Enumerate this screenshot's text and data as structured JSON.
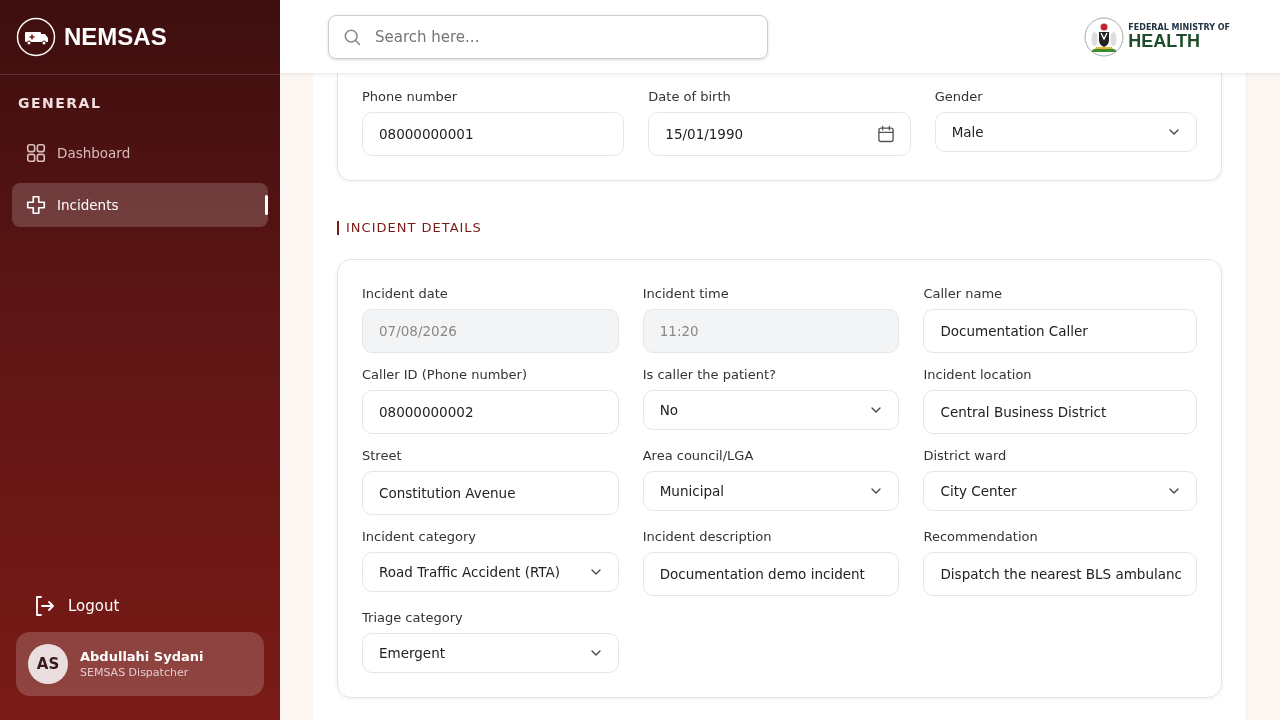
{
  "sidebar": {
    "brand": "NEMSAS",
    "section": "GENERAL",
    "items": [
      {
        "label": "Dashboard",
        "kind": "grid",
        "selected": false
      },
      {
        "label": "Incidents",
        "kind": "cross",
        "selected": true
      }
    ],
    "logout": "Logout",
    "user": {
      "initials": "AS",
      "name": "Abdullahi Sydani",
      "role": "SEMSAS Dispatcher"
    }
  },
  "header": {
    "search": {
      "placeholder": "Search here..."
    },
    "ministry": {
      "line1": "FEDERAL MINISTRY OF",
      "line2": "HEALTH"
    }
  },
  "patient_fields": [
    {
      "label": "Phone number",
      "value": "08000000001",
      "kind": "input",
      "disabled": false
    },
    {
      "label": "Date of birth",
      "value": "15/01/1990",
      "kind": "date",
      "disabled": false
    },
    {
      "label": "Gender",
      "value": "Male",
      "kind": "select",
      "disabled": false
    }
  ],
  "incident_section": {
    "title": "INCIDENT DETAILS",
    "fields": [
      {
        "label": "Incident date",
        "value": "07/08/2026",
        "kind": "input",
        "disabled": true
      },
      {
        "label": "Incident time",
        "value": "11:20",
        "kind": "input",
        "disabled": true
      },
      {
        "label": "Caller name",
        "value": "Documentation Caller",
        "kind": "input",
        "disabled": false
      },
      {
        "label": "Caller ID (Phone number)",
        "value": "08000000002",
        "kind": "input",
        "disabled": false
      },
      {
        "label": "Is caller the patient?",
        "value": "No",
        "kind": "select",
        "disabled": false
      },
      {
        "label": "Incident location",
        "value": "Central Business District",
        "kind": "input",
        "disabled": false
      },
      {
        "label": "Street",
        "value": "Constitution Avenue",
        "kind": "input",
        "disabled": false
      },
      {
        "label": "Area council/LGA",
        "value": "Municipal",
        "kind": "select",
        "disabled": false
      },
      {
        "label": "District ward",
        "value": "City Center",
        "kind": "select",
        "disabled": false
      },
      {
        "label": "Incident category",
        "value": "Road Traffic Accident (RTA)",
        "kind": "select",
        "disabled": false
      },
      {
        "label": "Incident description",
        "value": "Documentation demo incident",
        "kind": "input",
        "disabled": false
      },
      {
        "label": "Recommendation",
        "value": "Dispatch the nearest BLS ambulanc",
        "kind": "input",
        "disabled": false
      },
      {
        "label": "Triage category",
        "value": "Emergent",
        "kind": "select",
        "disabled": false
      }
    ]
  }
}
